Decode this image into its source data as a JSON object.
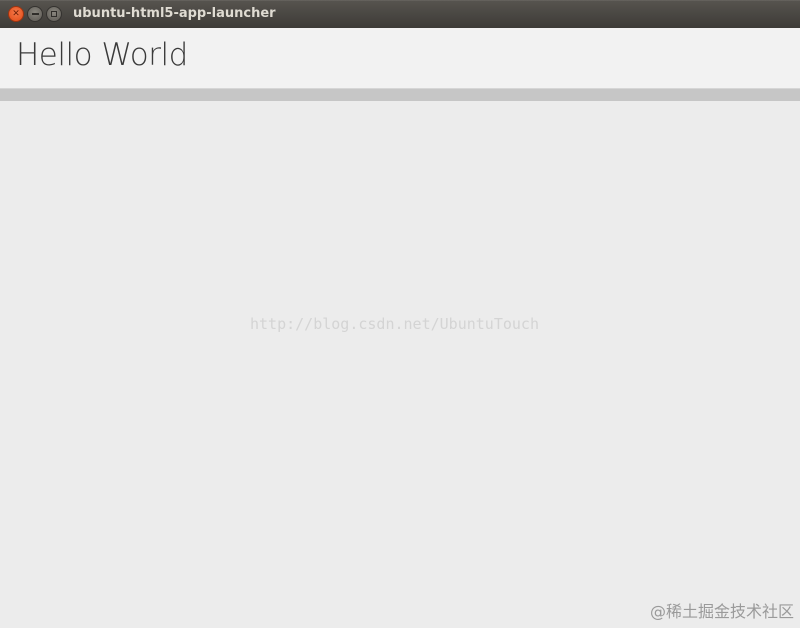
{
  "window": {
    "title": "ubuntu-html5-app-launcher"
  },
  "header": {
    "title": "Hello World"
  },
  "watermarks": {
    "url": "http://blog.csdn.net/UbuntuTouch",
    "site": "@稀土掘金技术社区"
  },
  "colors": {
    "titlebar": "#3d3b37",
    "close_button": "#df4a16",
    "background": "#ececec",
    "divider": "#c6c6c6"
  },
  "icons": {
    "close": "close-icon",
    "minimize": "minimize-icon",
    "maximize": "maximize-icon"
  }
}
